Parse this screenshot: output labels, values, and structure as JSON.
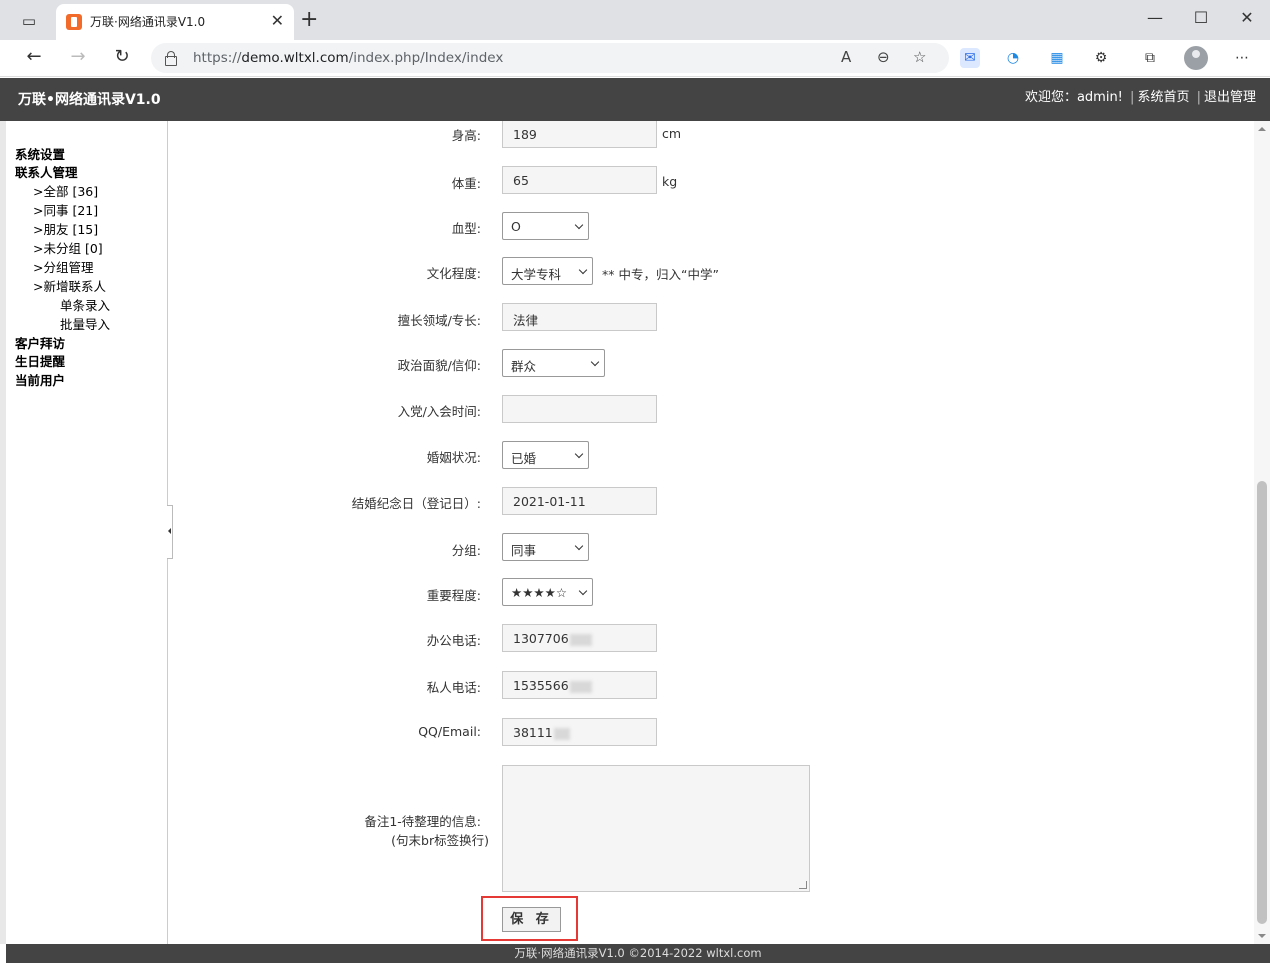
{
  "browser": {
    "tab_title": "万联·网络通讯录V1.0",
    "url_prefix": "https://",
    "url_host": "demo.wltxl.com",
    "url_path": "/index.php/Index/index"
  },
  "app": {
    "title": "万联•网络通讯录V1.0",
    "welcome": "欢迎您：admin!",
    "home_link": "系统首页",
    "logout_link": "退出管理",
    "footer": "万联·网络通讯录V1.0 ©2014-2022 wltxl.com"
  },
  "sidebar": {
    "system_settings": "系统设置",
    "contact_mgmt": "联系人管理",
    "all": ">全部 [36]",
    "colleagues": ">同事 [21]",
    "friends": ">朋友 [15]",
    "ungrouped": ">未分组 [0]",
    "group_mgmt": ">分组管理",
    "add_contact": ">新增联系人",
    "single_entry": "单条录入",
    "batch_import": "批量导入",
    "customer_visits": "客户拜访",
    "birthday_reminders": "生日提醒",
    "current_user": "当前用户"
  },
  "form": {
    "height_label": "身高:",
    "height_value": "189",
    "height_unit": "cm",
    "weight_label": "体重:",
    "weight_value": "65",
    "weight_unit": "kg",
    "blood_label": "血型:",
    "blood_value": "O",
    "education_label": "文化程度:",
    "education_value": "大学专科",
    "education_note": "** 中专，归入“中学”",
    "specialty_label": "擅长领域/专长:",
    "specialty_value": "法律",
    "political_label": "政治面貌/信仰:",
    "political_value": "群众",
    "party_date_label": "入党/入会时间:",
    "party_date_value": "",
    "marital_label": "婚姻状况:",
    "marital_value": "已婚",
    "wedding_label": "结婚纪念日（登记日）:",
    "wedding_value": "2021-01-11",
    "group_label": "分组:",
    "group_value": "同事",
    "importance_label": "重要程度:",
    "importance_value": "★★★★☆",
    "office_phone_label": "办公电话:",
    "office_phone_value": "1307706",
    "mobile_label": "私人电话:",
    "mobile_value": "1535566",
    "qq_label": "QQ/Email:",
    "qq_value": "38111",
    "remark_label_1": "备注1-待整理的信息:",
    "remark_label_2": "(句末br标签换行)",
    "save_label": "保 存"
  }
}
